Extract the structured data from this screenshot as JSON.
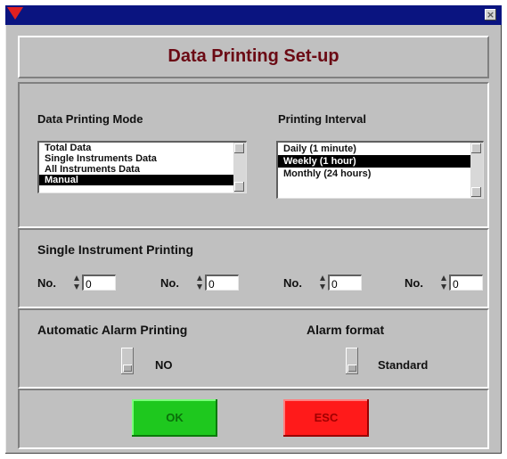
{
  "window": {
    "title": "",
    "close_glyph": "×"
  },
  "header": {
    "title": "Data Printing Set-up"
  },
  "mode": {
    "label": "Data Printing Mode",
    "items": [
      "Total Data",
      "Single Instruments Data",
      "All Instruments Data",
      "Manual"
    ],
    "selected_index": 3
  },
  "interval": {
    "label": "Printing Interval",
    "items": [
      "Daily  (1 minute)",
      "Weekly (1 hour)",
      "Monthly (24 hours)"
    ],
    "selected_index": 1
  },
  "single": {
    "label": "Single Instrument Printing",
    "fields": [
      {
        "label": "No.",
        "value": "0"
      },
      {
        "label": "No.",
        "value": "0"
      },
      {
        "label": "No.",
        "value": "0"
      },
      {
        "label": "No.",
        "value": "0"
      }
    ]
  },
  "alarm": {
    "auto_label": "Automatic Alarm Printing",
    "auto_value": "NO",
    "format_label": "Alarm format",
    "format_value": "Standard"
  },
  "buttons": {
    "ok": "OK",
    "esc": "ESC"
  },
  "colors": {
    "ok": "#1ec81e",
    "esc": "#ff1a1a",
    "title_text": "#6b0a14",
    "titlebar": "#0a1480"
  }
}
